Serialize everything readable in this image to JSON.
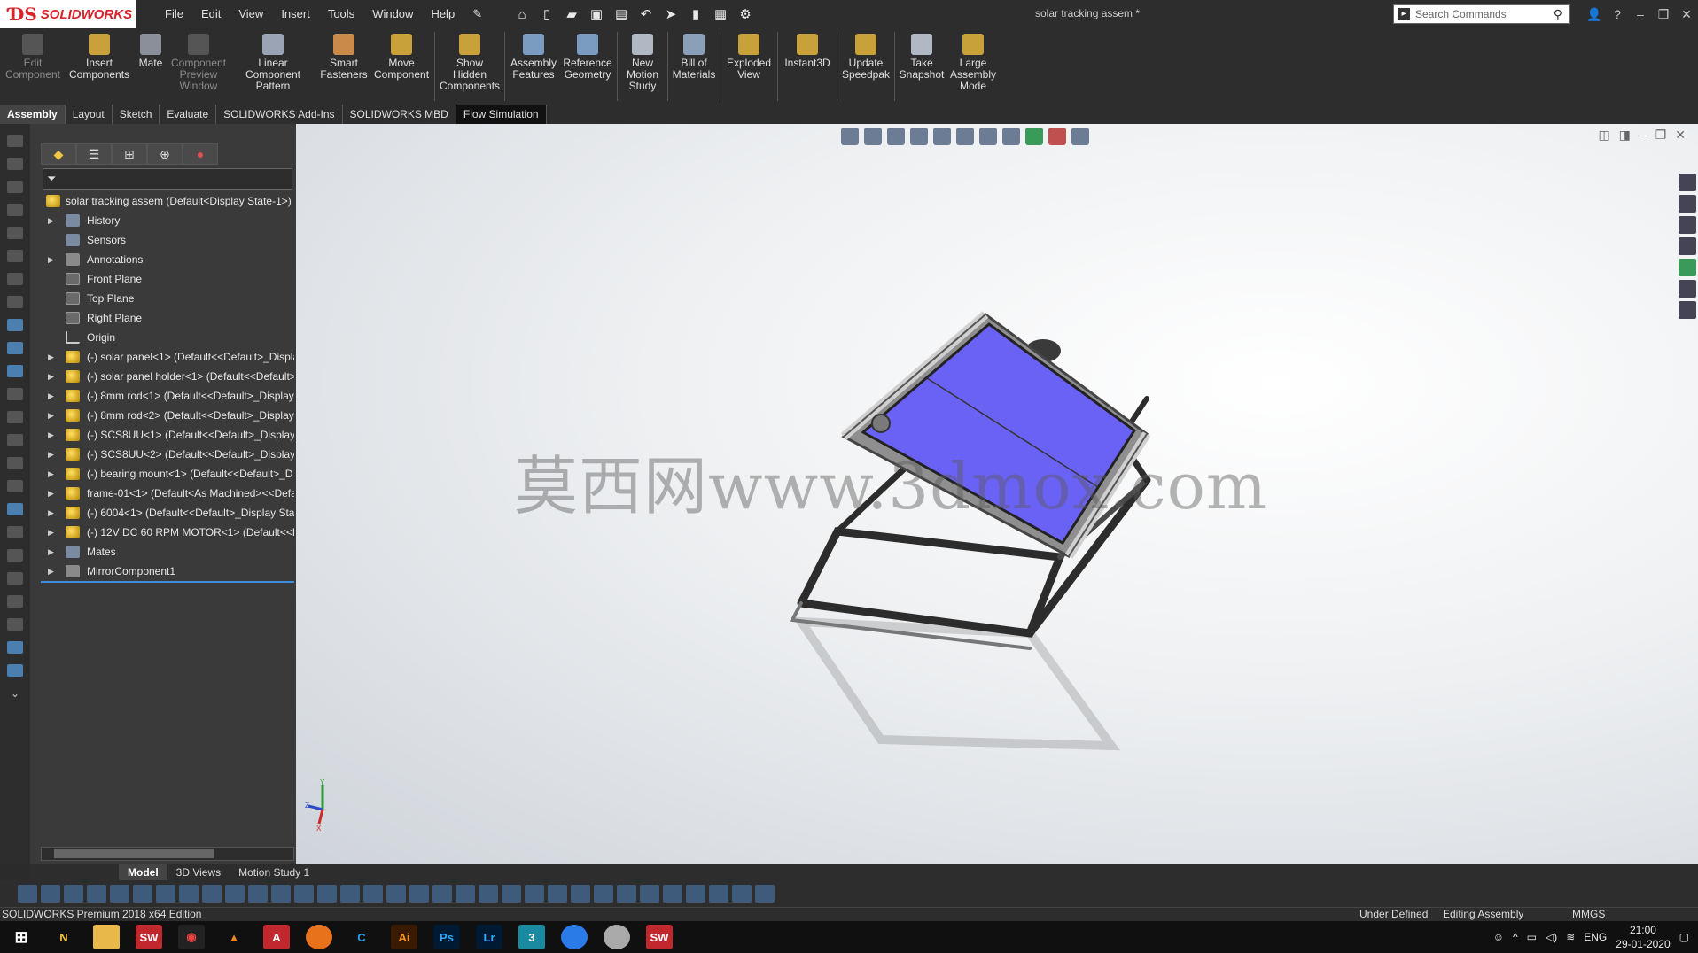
{
  "app": {
    "brand": "SOLIDWORKS",
    "doc_title": "solar tracking assem *"
  },
  "menu": [
    "File",
    "Edit",
    "View",
    "Insert",
    "Tools",
    "Window",
    "Help"
  ],
  "search": {
    "placeholder": "Search Commands"
  },
  "commands": [
    {
      "label": "Edit Component",
      "enabled": false
    },
    {
      "label": "Insert Components",
      "enabled": true
    },
    {
      "label": "Mate",
      "enabled": true
    },
    {
      "label": "Component Preview Window",
      "enabled": false
    },
    {
      "label": "Linear Component Pattern",
      "enabled": true
    },
    {
      "label": "Smart Fasteners",
      "enabled": true
    },
    {
      "label": "Move Component",
      "enabled": true
    },
    {
      "label": "Show Hidden Components",
      "enabled": true
    },
    {
      "label": "Assembly Features",
      "enabled": true
    },
    {
      "label": "Reference Geometry",
      "enabled": true
    },
    {
      "label": "New Motion Study",
      "enabled": true
    },
    {
      "label": "Bill of Materials",
      "enabled": true
    },
    {
      "label": "Exploded View",
      "enabled": true
    },
    {
      "label": "Instant3D",
      "enabled": true
    },
    {
      "label": "Update Speedpak",
      "enabled": true
    },
    {
      "label": "Take Snapshot",
      "enabled": true
    },
    {
      "label": "Large Assembly Mode",
      "enabled": true
    }
  ],
  "tabs": [
    "Assembly",
    "Layout",
    "Sketch",
    "Evaluate",
    "SOLIDWORKS Add-Ins",
    "SOLIDWORKS MBD",
    "Flow Simulation"
  ],
  "tree": {
    "root": "solar tracking assem  (Default<Display State-1>)",
    "items": [
      {
        "label": "History",
        "icon": "history-icon",
        "expand": true
      },
      {
        "label": "Sensors",
        "icon": "sensors-icon",
        "expand": false
      },
      {
        "label": "Annotations",
        "icon": "annotations-icon",
        "expand": true
      },
      {
        "label": "Front Plane",
        "icon": "plane-icon",
        "expand": false
      },
      {
        "label": "Top Plane",
        "icon": "plane-icon",
        "expand": false
      },
      {
        "label": "Right Plane",
        "icon": "plane-icon",
        "expand": false
      },
      {
        "label": "Origin",
        "icon": "origin-icon",
        "expand": false
      },
      {
        "label": "(-) solar panel<1> (Default<<Default>_Displa",
        "icon": "part-icon",
        "expand": true
      },
      {
        "label": "(-) solar panel holder<1> (Default<<Default>",
        "icon": "part-icon",
        "expand": true
      },
      {
        "label": "(-) 8mm rod<1> (Default<<Default>_Display",
        "icon": "part-icon",
        "expand": true
      },
      {
        "label": "(-) 8mm rod<2> (Default<<Default>_Display",
        "icon": "part-icon",
        "expand": true
      },
      {
        "label": "(-) SCS8UU<1> (Default<<Default>_Display S",
        "icon": "part-icon",
        "expand": true
      },
      {
        "label": "(-) SCS8UU<2> (Default<<Default>_Display S",
        "icon": "part-icon",
        "expand": true
      },
      {
        "label": "(-) bearing mount<1> (Default<<Default>_D",
        "icon": "part-icon",
        "expand": true
      },
      {
        "label": "frame-01<1> (Default<As Machined><<Defa",
        "icon": "part-icon",
        "expand": true
      },
      {
        "label": "(-) 6004<1> (Default<<Default>_Display Stat",
        "icon": "part-icon",
        "expand": true
      },
      {
        "label": "(-) 12V DC 60 RPM MOTOR<1> (Default<<De",
        "icon": "part-icon",
        "expand": true
      },
      {
        "label": "Mates",
        "icon": "mates-icon",
        "expand": true
      },
      {
        "label": "MirrorComponent1",
        "icon": "mirror-icon",
        "expand": true
      }
    ]
  },
  "bottom_tabs": [
    "Model",
    "3D Views",
    "Motion Study 1"
  ],
  "watermark": "莫西网www.3dmox.com",
  "triad": {
    "x": "X",
    "y": "Y",
    "z": "Z"
  },
  "status": {
    "product": "SOLIDWORKS Premium 2018 x64 Edition",
    "state": "Under Defined",
    "mode": "Editing Assembly",
    "units": "MMGS"
  },
  "taskbar": {
    "apps": [
      "Norton",
      "Explorer",
      "SW 2018",
      "Media",
      "VLC",
      "Acrobat",
      "Firefox",
      "CCleaner",
      "Ai",
      "Ps",
      "Lr",
      "3",
      "Chrome",
      "Cloud",
      "SW 2018"
    ],
    "lang": "ENG",
    "time": "21:00",
    "date": "29-01-2020"
  },
  "colors": {
    "panel_blue": "#6b6bff",
    "brand_red": "#d8232a"
  }
}
